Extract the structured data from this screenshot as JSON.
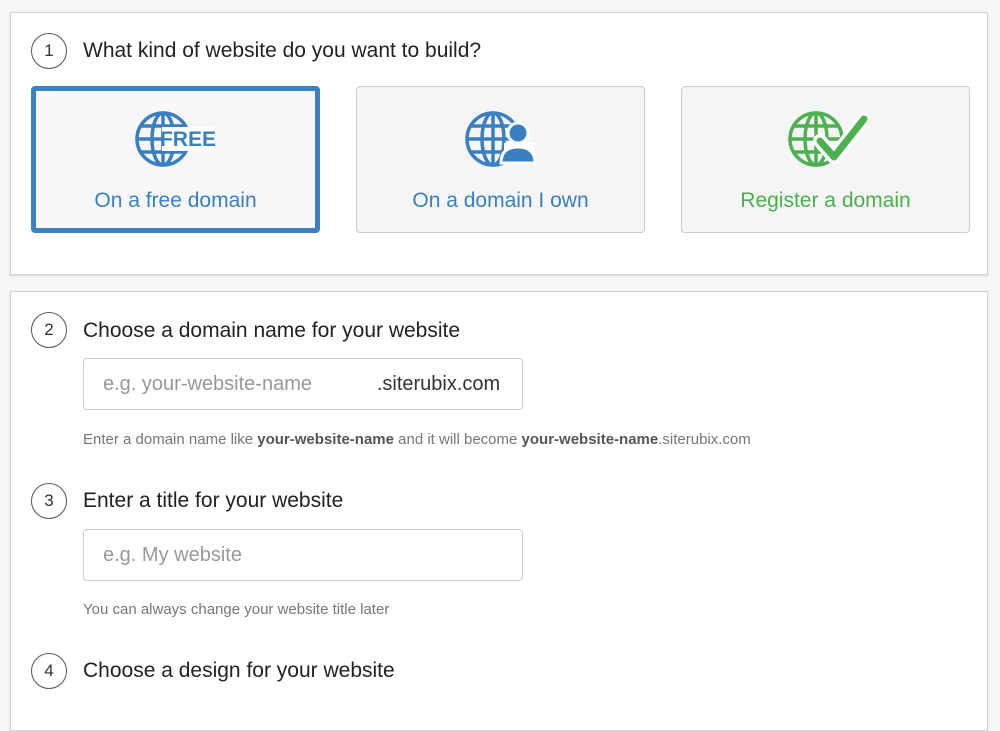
{
  "step1": {
    "number": "1",
    "title": "What kind of website do you want to build?",
    "options": [
      {
        "label": "On a free domain",
        "icon": "globe-free-icon",
        "icon_text": "FREE",
        "color": "#3a7fc1",
        "selected": true
      },
      {
        "label": "On a domain I own",
        "icon": "globe-user-icon",
        "color": "#3a7fc1",
        "selected": false
      },
      {
        "label": "Register a domain",
        "icon": "globe-check-icon",
        "color": "#4caf50",
        "selected": false
      }
    ]
  },
  "step2": {
    "number": "2",
    "title": "Choose a domain name for your website",
    "input_value": "",
    "input_placeholder": "e.g. your-website-name",
    "suffix": ".siterubix.com",
    "help": {
      "part1": "Enter a domain name like ",
      "bold1": "your-website-name",
      "part2": " and it will become ",
      "bold2": "your-website-name",
      "part3": ".siterubix.com"
    }
  },
  "step3": {
    "number": "3",
    "title": "Enter a title for your website",
    "input_value": "",
    "input_placeholder": "e.g. My website",
    "help": "You can always change your website title later"
  },
  "step4": {
    "number": "4",
    "title": "Choose a design for your website"
  },
  "colors": {
    "accent": "#3b82c4",
    "link_blue": "#3a7fc1",
    "green": "#4caf50"
  }
}
